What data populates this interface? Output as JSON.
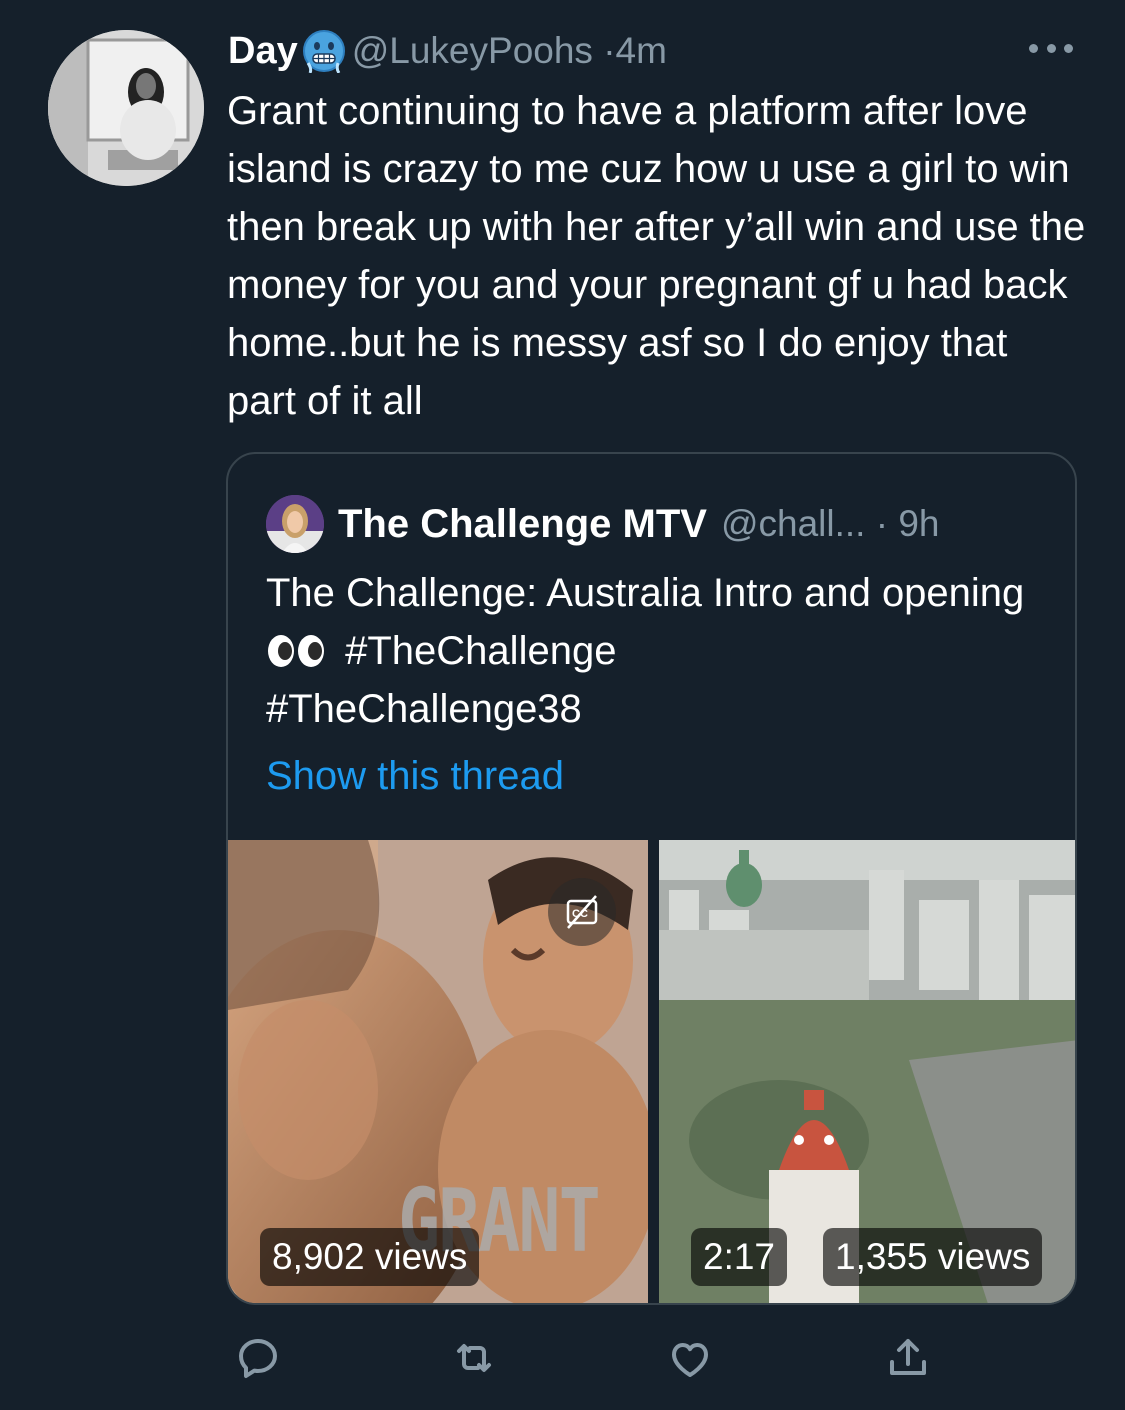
{
  "tweet": {
    "display_name": "Day",
    "name_emoji": "cold-face-emoji",
    "handle": "@LukeyPoohs",
    "separator": "·",
    "time": "4m",
    "text": "Grant continuing to have a platform after love island is crazy to me cuz how u use a girl to win then break up with her after y’all win and use the money for you and your pregnant gf u had back home..but he is messy asf so I do enjoy that part of it all"
  },
  "quote": {
    "display_name": "The Challenge MTV",
    "handle": "@chall...",
    "separator": "·",
    "time": "9h",
    "text_part1": "The Challenge: Australia Intro and opening",
    "eyes_emoji": "eyes-emoji",
    "hashtag1": "#TheChallenge",
    "hashtag2": "#TheChallenge38",
    "show_thread": "Show this thread",
    "media": [
      {
        "overlay_text": "GRANT",
        "views": "8,902 views",
        "has_captions_button": true
      },
      {
        "duration": "2:17",
        "views": "1,355 views"
      }
    ]
  },
  "actions": [
    {
      "name": "reply",
      "icon": "reply-icon"
    },
    {
      "name": "retweet",
      "icon": "retweet-icon"
    },
    {
      "name": "like",
      "icon": "heart-icon"
    },
    {
      "name": "share",
      "icon": "share-icon"
    }
  ],
  "colors": {
    "background": "#15202b",
    "secondary_text": "#8899a6",
    "link": "#1d9bf0",
    "border": "#38444d"
  }
}
